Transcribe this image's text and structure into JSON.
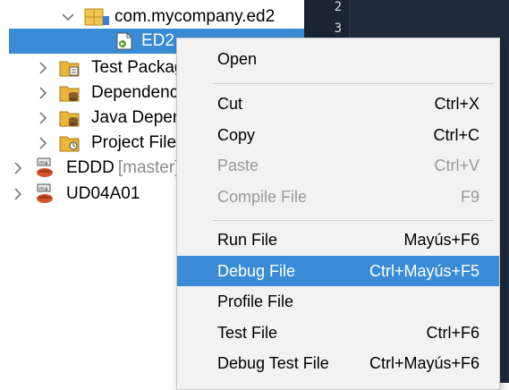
{
  "tree": {
    "items": [
      {
        "label": "com.mycompany.ed2",
        "suffix": "",
        "icon": "package-icon"
      },
      {
        "label": "ED2",
        "suffix": "",
        "icon": "java-file-icon"
      },
      {
        "label": "Test Packag",
        "suffix": "",
        "icon": "test-folder-icon"
      },
      {
        "label": "Dependenc",
        "suffix": "",
        "icon": "dependencies-folder-icon"
      },
      {
        "label": "Java Depen",
        "suffix": "",
        "icon": "java-dependencies-folder-icon"
      },
      {
        "label": "Project File",
        "suffix": "",
        "icon": "project-files-folder-icon"
      },
      {
        "label": "EDDD",
        "suffix": "[master]",
        "icon": "maven-project-icon"
      },
      {
        "label": "UD04A01",
        "suffix": "",
        "icon": "maven-project-icon"
      }
    ]
  },
  "editor": {
    "line_numbers": [
      "2",
      "3"
    ]
  },
  "context_menu": {
    "items": [
      {
        "label": "Open",
        "shortcut": "",
        "disabled": false
      },
      {
        "label": "Cut",
        "shortcut": "Ctrl+X",
        "disabled": false
      },
      {
        "label": "Copy",
        "shortcut": "Ctrl+C",
        "disabled": false
      },
      {
        "label": "Paste",
        "shortcut": "Ctrl+V",
        "disabled": true
      },
      {
        "label": "Compile File",
        "shortcut": "F9",
        "disabled": true
      },
      {
        "label": "Run File",
        "shortcut": "Mayús+F6",
        "disabled": false
      },
      {
        "label": "Debug File",
        "shortcut": "Ctrl+Mayús+F5",
        "disabled": false,
        "highlighted": true
      },
      {
        "label": "Profile File",
        "shortcut": "",
        "disabled": false
      },
      {
        "label": "Test File",
        "shortcut": "Ctrl+F6",
        "disabled": false
      },
      {
        "label": "Debug Test File",
        "shortcut": "Ctrl+Mayús+F6",
        "disabled": false
      }
    ]
  },
  "colors": {
    "selection": "#3a8bd6",
    "menu_background": "#f2f2f2",
    "editor_background": "#1f2a3a"
  }
}
